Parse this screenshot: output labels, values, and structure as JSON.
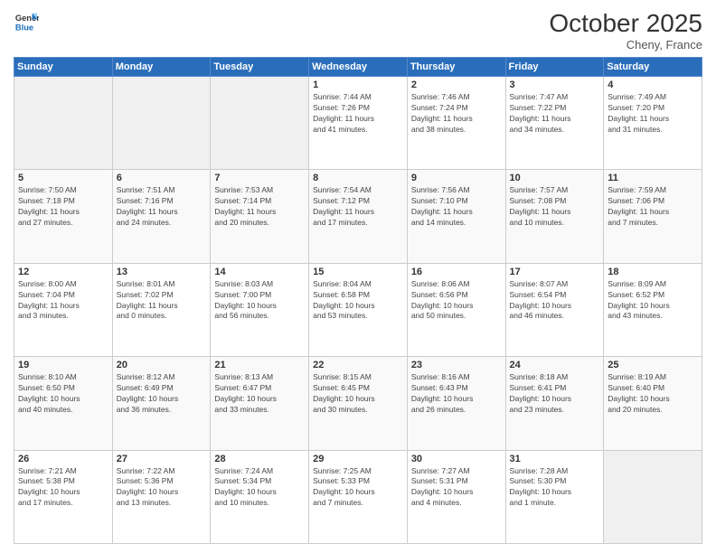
{
  "header": {
    "logo_line1": "General",
    "logo_line2": "Blue",
    "month": "October 2025",
    "location": "Cheny, France"
  },
  "weekdays": [
    "Sunday",
    "Monday",
    "Tuesday",
    "Wednesday",
    "Thursday",
    "Friday",
    "Saturday"
  ],
  "weeks": [
    [
      {
        "day": "",
        "info": ""
      },
      {
        "day": "",
        "info": ""
      },
      {
        "day": "",
        "info": ""
      },
      {
        "day": "1",
        "info": "Sunrise: 7:44 AM\nSunset: 7:26 PM\nDaylight: 11 hours\nand 41 minutes."
      },
      {
        "day": "2",
        "info": "Sunrise: 7:46 AM\nSunset: 7:24 PM\nDaylight: 11 hours\nand 38 minutes."
      },
      {
        "day": "3",
        "info": "Sunrise: 7:47 AM\nSunset: 7:22 PM\nDaylight: 11 hours\nand 34 minutes."
      },
      {
        "day": "4",
        "info": "Sunrise: 7:49 AM\nSunset: 7:20 PM\nDaylight: 11 hours\nand 31 minutes."
      }
    ],
    [
      {
        "day": "5",
        "info": "Sunrise: 7:50 AM\nSunset: 7:18 PM\nDaylight: 11 hours\nand 27 minutes."
      },
      {
        "day": "6",
        "info": "Sunrise: 7:51 AM\nSunset: 7:16 PM\nDaylight: 11 hours\nand 24 minutes."
      },
      {
        "day": "7",
        "info": "Sunrise: 7:53 AM\nSunset: 7:14 PM\nDaylight: 11 hours\nand 20 minutes."
      },
      {
        "day": "8",
        "info": "Sunrise: 7:54 AM\nSunset: 7:12 PM\nDaylight: 11 hours\nand 17 minutes."
      },
      {
        "day": "9",
        "info": "Sunrise: 7:56 AM\nSunset: 7:10 PM\nDaylight: 11 hours\nand 14 minutes."
      },
      {
        "day": "10",
        "info": "Sunrise: 7:57 AM\nSunset: 7:08 PM\nDaylight: 11 hours\nand 10 minutes."
      },
      {
        "day": "11",
        "info": "Sunrise: 7:59 AM\nSunset: 7:06 PM\nDaylight: 11 hours\nand 7 minutes."
      }
    ],
    [
      {
        "day": "12",
        "info": "Sunrise: 8:00 AM\nSunset: 7:04 PM\nDaylight: 11 hours\nand 3 minutes."
      },
      {
        "day": "13",
        "info": "Sunrise: 8:01 AM\nSunset: 7:02 PM\nDaylight: 11 hours\nand 0 minutes."
      },
      {
        "day": "14",
        "info": "Sunrise: 8:03 AM\nSunset: 7:00 PM\nDaylight: 10 hours\nand 56 minutes."
      },
      {
        "day": "15",
        "info": "Sunrise: 8:04 AM\nSunset: 6:58 PM\nDaylight: 10 hours\nand 53 minutes."
      },
      {
        "day": "16",
        "info": "Sunrise: 8:06 AM\nSunset: 6:56 PM\nDaylight: 10 hours\nand 50 minutes."
      },
      {
        "day": "17",
        "info": "Sunrise: 8:07 AM\nSunset: 6:54 PM\nDaylight: 10 hours\nand 46 minutes."
      },
      {
        "day": "18",
        "info": "Sunrise: 8:09 AM\nSunset: 6:52 PM\nDaylight: 10 hours\nand 43 minutes."
      }
    ],
    [
      {
        "day": "19",
        "info": "Sunrise: 8:10 AM\nSunset: 6:50 PM\nDaylight: 10 hours\nand 40 minutes."
      },
      {
        "day": "20",
        "info": "Sunrise: 8:12 AM\nSunset: 6:49 PM\nDaylight: 10 hours\nand 36 minutes."
      },
      {
        "day": "21",
        "info": "Sunrise: 8:13 AM\nSunset: 6:47 PM\nDaylight: 10 hours\nand 33 minutes."
      },
      {
        "day": "22",
        "info": "Sunrise: 8:15 AM\nSunset: 6:45 PM\nDaylight: 10 hours\nand 30 minutes."
      },
      {
        "day": "23",
        "info": "Sunrise: 8:16 AM\nSunset: 6:43 PM\nDaylight: 10 hours\nand 26 minutes."
      },
      {
        "day": "24",
        "info": "Sunrise: 8:18 AM\nSunset: 6:41 PM\nDaylight: 10 hours\nand 23 minutes."
      },
      {
        "day": "25",
        "info": "Sunrise: 8:19 AM\nSunset: 6:40 PM\nDaylight: 10 hours\nand 20 minutes."
      }
    ],
    [
      {
        "day": "26",
        "info": "Sunrise: 7:21 AM\nSunset: 5:38 PM\nDaylight: 10 hours\nand 17 minutes."
      },
      {
        "day": "27",
        "info": "Sunrise: 7:22 AM\nSunset: 5:36 PM\nDaylight: 10 hours\nand 13 minutes."
      },
      {
        "day": "28",
        "info": "Sunrise: 7:24 AM\nSunset: 5:34 PM\nDaylight: 10 hours\nand 10 minutes."
      },
      {
        "day": "29",
        "info": "Sunrise: 7:25 AM\nSunset: 5:33 PM\nDaylight: 10 hours\nand 7 minutes."
      },
      {
        "day": "30",
        "info": "Sunrise: 7:27 AM\nSunset: 5:31 PM\nDaylight: 10 hours\nand 4 minutes."
      },
      {
        "day": "31",
        "info": "Sunrise: 7:28 AM\nSunset: 5:30 PM\nDaylight: 10 hours\nand 1 minute."
      },
      {
        "day": "",
        "info": ""
      }
    ]
  ]
}
